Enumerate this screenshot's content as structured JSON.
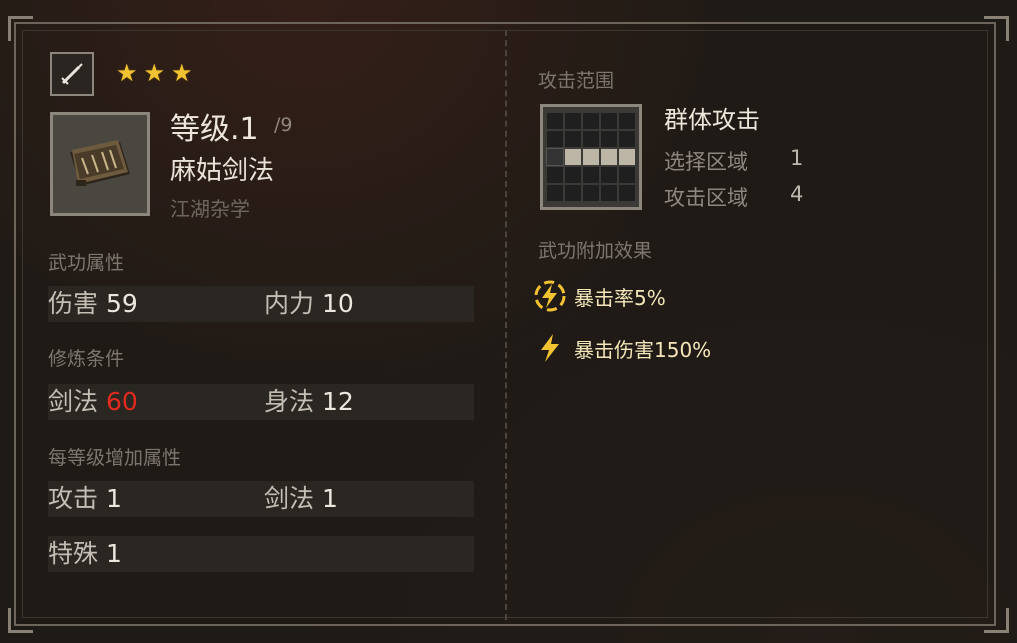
{
  "header": {
    "stars": [
      "★",
      "★",
      "★"
    ],
    "level_label": "等级.1",
    "level_max": "/9",
    "skill_name": "麻姑剑法",
    "skill_category": "江湖杂学"
  },
  "attributes": {
    "title": "武功属性",
    "rows": [
      [
        {
          "label": "伤害",
          "value": "59"
        },
        {
          "label": "内力",
          "value": "10"
        }
      ]
    ]
  },
  "requirements": {
    "title": "修炼条件",
    "rows": [
      [
        {
          "label": "剑法",
          "value": "60"
        },
        {
          "label": "身法",
          "value": "12"
        }
      ]
    ]
  },
  "per_level": {
    "title": "每等级增加属性",
    "rows": [
      [
        {
          "label": "攻击",
          "value": "1"
        },
        {
          "label": "剑法",
          "value": "1"
        }
      ],
      [
        {
          "label": "特殊",
          "value": "1"
        }
      ]
    ]
  },
  "range": {
    "title": "攻击范围",
    "type": "群体攻击",
    "select_label": "选择区域",
    "select_value": "1",
    "attack_label": "攻击区域",
    "attack_value": "4"
  },
  "effects": {
    "title": "武功附加效果",
    "items": [
      {
        "icon": "lightning-circle-icon",
        "text": "暴击率5%"
      },
      {
        "icon": "lightning-icon",
        "text": "暴击伤害150%"
      }
    ]
  },
  "colors": {
    "star": "#f1c232",
    "requirement_unmet": "#e02a1e",
    "effect_text": "#f3e6b8",
    "effect_icon": "#f2c230"
  }
}
